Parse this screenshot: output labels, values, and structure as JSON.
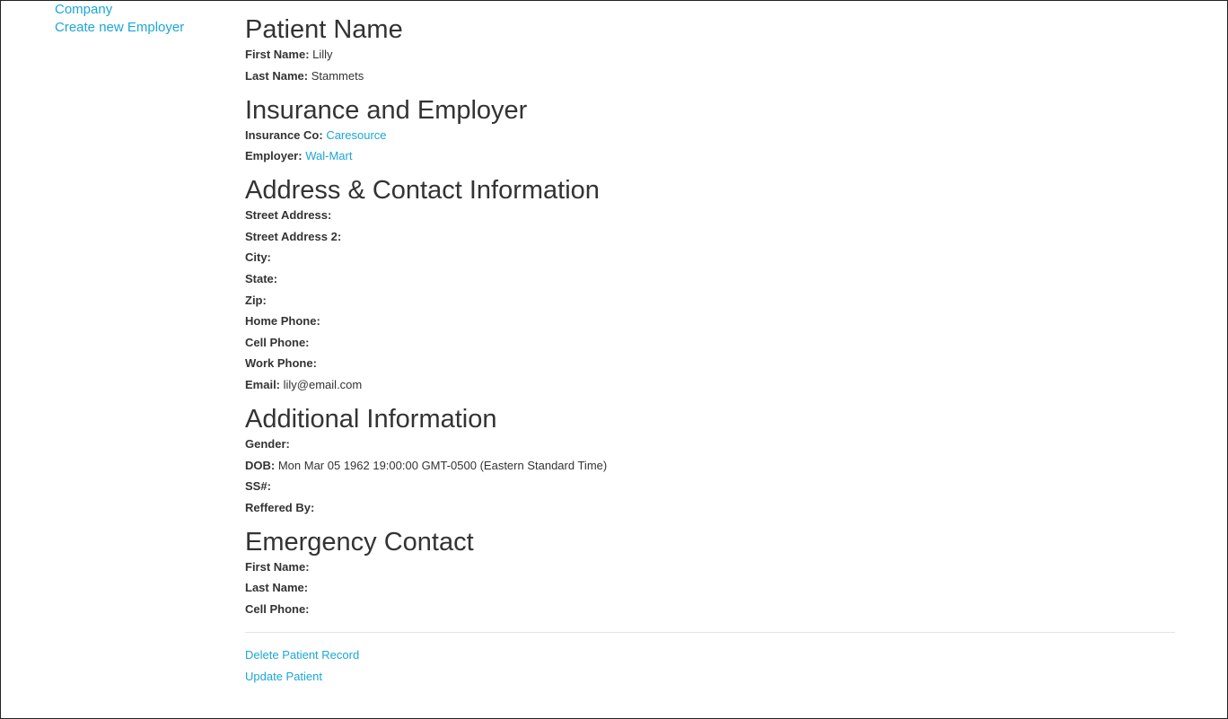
{
  "sidebar": {
    "links": [
      "Company",
      "Create new Employer"
    ]
  },
  "patient_name": {
    "heading": "Patient Name",
    "first_name_label": "First Name:",
    "first_name_value": "Lilly",
    "last_name_label": "Last Name:",
    "last_name_value": "Stammets"
  },
  "insurance": {
    "heading": "Insurance and Employer",
    "insurance_label": "Insurance Co:",
    "insurance_value": "Caresource",
    "employer_label": "Employer:",
    "employer_value": "Wal-Mart"
  },
  "address": {
    "heading": "Address & Contact Information",
    "street_label": "Street Address:",
    "street_value": "",
    "street2_label": "Street Address 2:",
    "street2_value": "",
    "city_label": "City:",
    "city_value": "",
    "state_label": "State:",
    "state_value": "",
    "zip_label": "Zip:",
    "zip_value": "",
    "home_phone_label": "Home Phone:",
    "home_phone_value": "",
    "cell_phone_label": "Cell Phone:",
    "cell_phone_value": "",
    "work_phone_label": "Work Phone:",
    "work_phone_value": "",
    "email_label": "Email:",
    "email_value": "lily@email.com"
  },
  "additional": {
    "heading": "Additional Information",
    "gender_label": "Gender:",
    "gender_value": "",
    "dob_label": "DOB:",
    "dob_value": "Mon Mar 05 1962 19:00:00 GMT-0500 (Eastern Standard Time)",
    "ssn_label": "SS#:",
    "ssn_value": "",
    "referred_label": "Reffered By:",
    "referred_value": ""
  },
  "emergency": {
    "heading": "Emergency Contact",
    "first_name_label": "First Name:",
    "first_name_value": "",
    "last_name_label": "Last Name:",
    "last_name_value": "",
    "cell_phone_label": "Cell Phone:",
    "cell_phone_value": ""
  },
  "actions": {
    "delete_label": "Delete Patient Record",
    "update_label": "Update Patient"
  },
  "colors": {
    "link": "#1ba7d6",
    "text": "#333333"
  }
}
